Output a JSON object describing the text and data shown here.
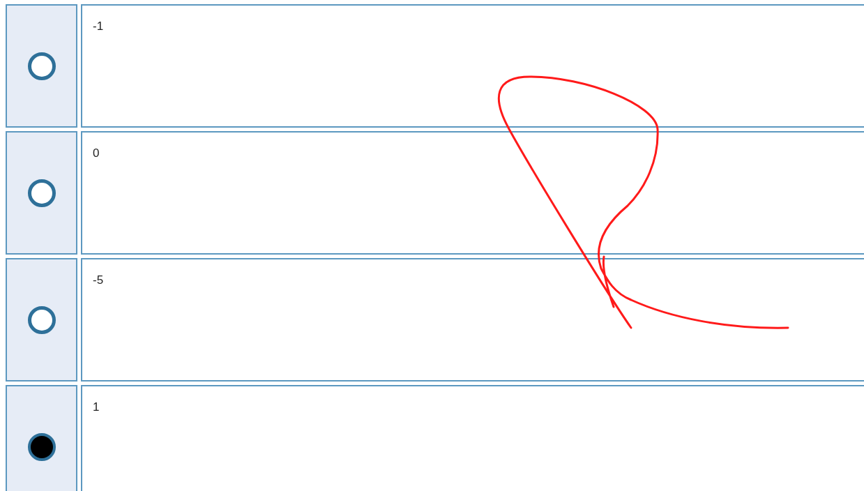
{
  "options": [
    {
      "text": "-1",
      "selected": false
    },
    {
      "text": "0",
      "selected": false
    },
    {
      "text": "-5",
      "selected": false
    },
    {
      "text": "1",
      "selected": true
    }
  ]
}
